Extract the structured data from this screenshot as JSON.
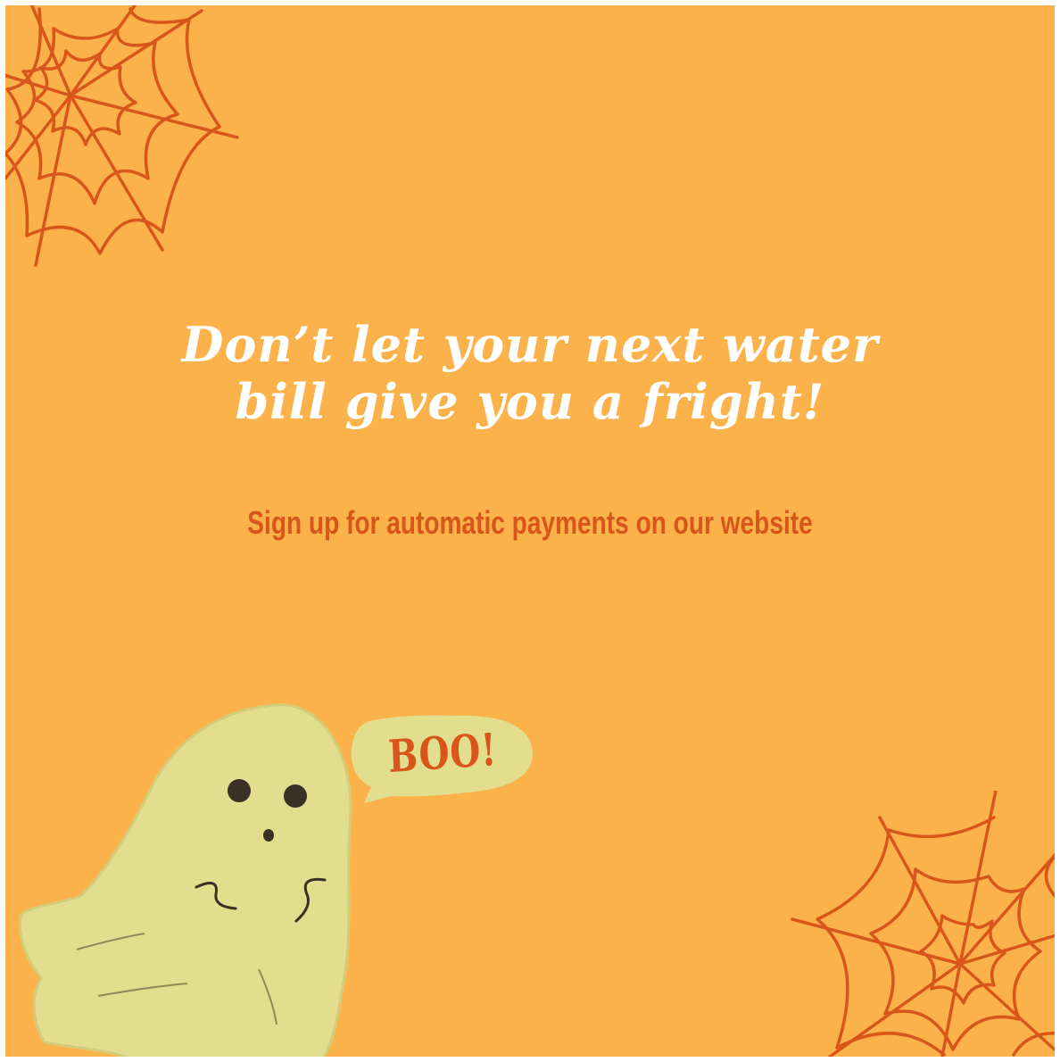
{
  "headline": {
    "line1": "Don’t let your next water",
    "line2": "bill give you a fright!"
  },
  "subheadline": "Sign up for automatic payments on our website",
  "speech_bubble": {
    "text": "BOO!"
  },
  "colors": {
    "background": "#fcb24b",
    "headline": "#ffffff",
    "accent": "#d9561b",
    "ghost": "#e3dd8e",
    "web": "#d9561b"
  },
  "decorations": [
    "spider-web-icon",
    "ghost-illustration",
    "speech-bubble"
  ]
}
